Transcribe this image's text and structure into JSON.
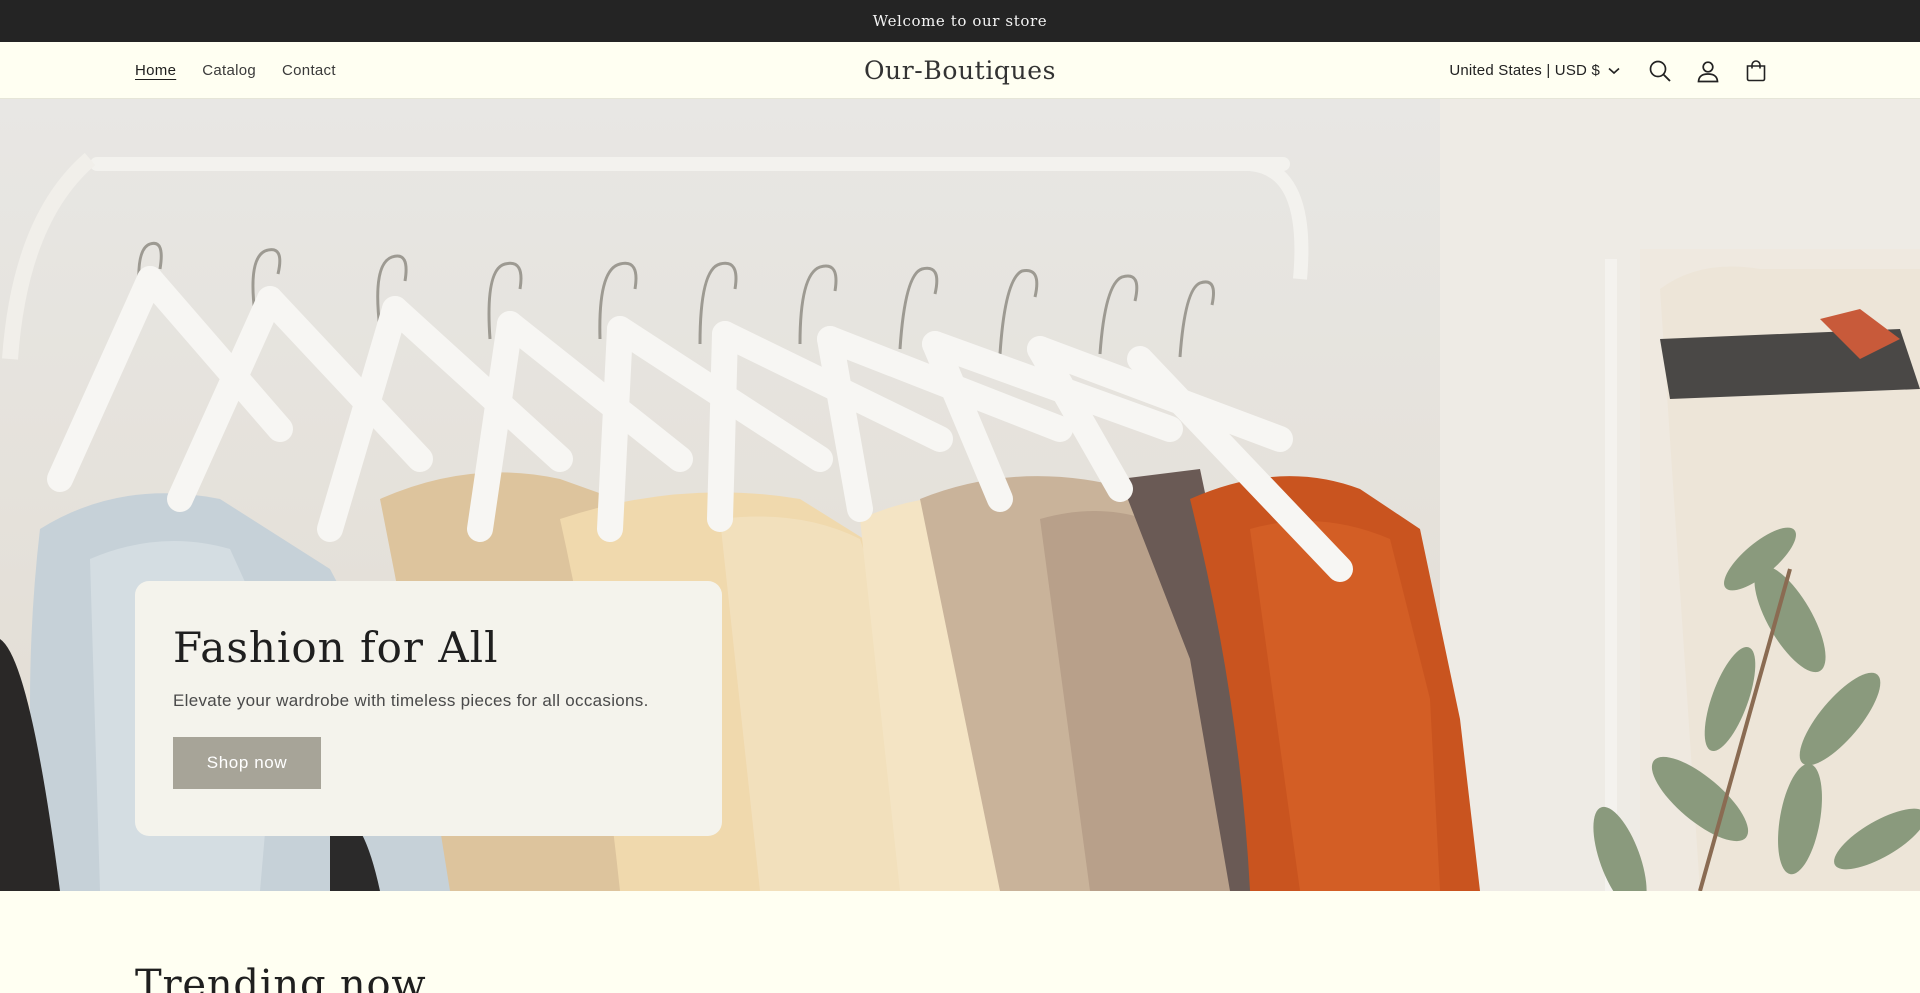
{
  "announcement": {
    "text": "Welcome to our store"
  },
  "header": {
    "nav": [
      {
        "label": "Home",
        "active": true
      },
      {
        "label": "Catalog",
        "active": false
      },
      {
        "label": "Contact",
        "active": false
      }
    ],
    "logo": "Our-Boutiques",
    "locale": "United States | USD $",
    "icons": [
      "search-icon",
      "account-icon",
      "cart-icon"
    ]
  },
  "hero": {
    "title": "Fashion for All",
    "subtitle": "Elevate your wardrobe with timeless pieces for all occasions.",
    "button": "Shop now"
  },
  "trending": {
    "title": "Trending now"
  },
  "colors": {
    "announcement_bg": "#242424",
    "page_bg": "#fffff2",
    "card_bg": "#f4f3ec",
    "button_bg": "#a7a498",
    "accent_orange": "#c9541f"
  }
}
